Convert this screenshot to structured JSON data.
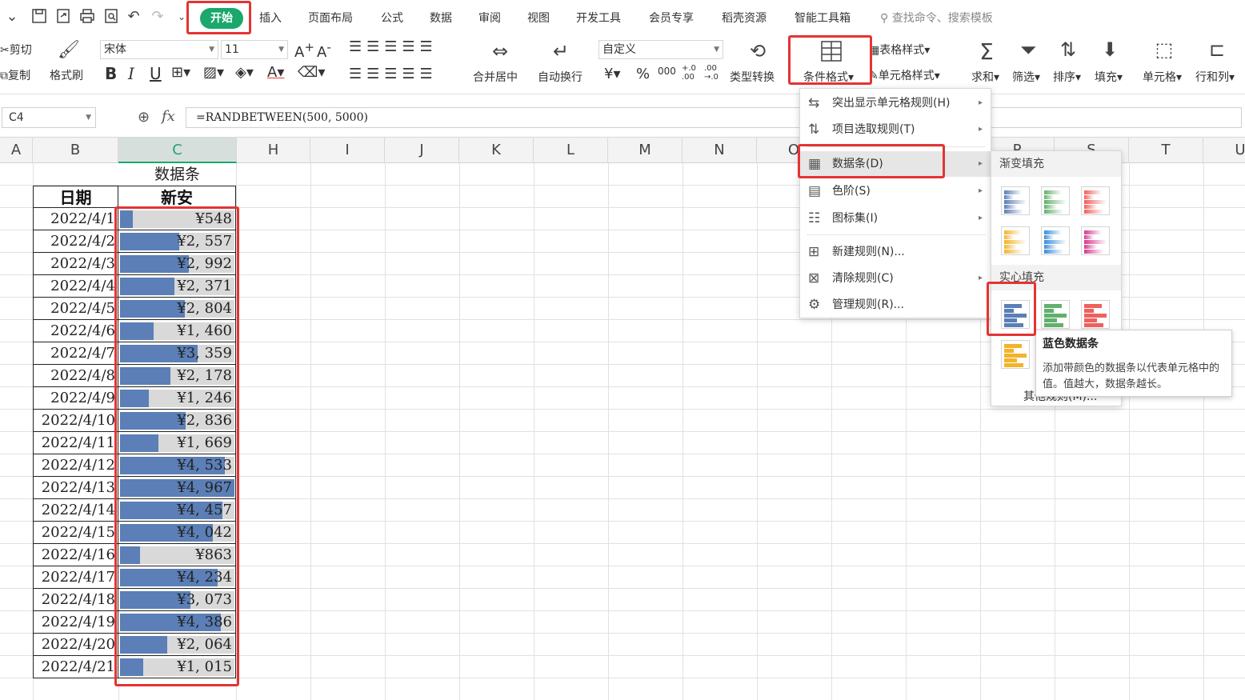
{
  "quick_access": [
    "chevron-down-icon",
    "save-icon",
    "export-icon",
    "print-icon",
    "print-preview-icon",
    "undo-icon",
    "redo-icon",
    "more-icon"
  ],
  "menu_tabs": [
    "开始",
    "插入",
    "页面布局",
    "公式",
    "数据",
    "审阅",
    "视图",
    "开发工具",
    "会员专享",
    "稻壳资源",
    "智能工具箱"
  ],
  "search_placeholder": "查找命令、搜索模板",
  "ribbon": {
    "cut": "剪切",
    "copy": "复制",
    "format_painter": "格式刷",
    "font_name": "宋体",
    "font_size": "11",
    "bold": "B",
    "italic": "I",
    "underline": "U",
    "merge_center": "合并居中",
    "auto_wrap": "自动换行",
    "number_format": "自定义",
    "currency": "¥",
    "percent": "%",
    "thousands": "000",
    "inc_decimal": "+.0 .00",
    "dec_decimal": ".00 →.0",
    "type_convert": "类型转换",
    "conditional_format": "条件格式",
    "table_style": "表格样式",
    "cell_style": "单元格样式",
    "sum": "求和",
    "filter": "筛选",
    "sort": "排序",
    "fill": "填充",
    "cell": "单元格",
    "row_col": "行和列"
  },
  "name_box": "C4",
  "formula": "=RANDBETWEEN(500, 5000)",
  "columns": [
    "A",
    "B",
    "C",
    "H",
    "I",
    "J",
    "K",
    "L",
    "M",
    "N",
    "O",
    "P",
    "S",
    "T",
    "U"
  ],
  "sheet": {
    "title": "数据条",
    "header_date": "日期",
    "header_value": "新安",
    "rows": [
      {
        "date": "2022/4/1",
        "value": 548,
        "label": "¥548"
      },
      {
        "date": "2022/4/2",
        "value": 2557,
        "label": "¥2, 557"
      },
      {
        "date": "2022/4/3",
        "value": 2992,
        "label": "¥2, 992"
      },
      {
        "date": "2022/4/4",
        "value": 2371,
        "label": "¥2, 371"
      },
      {
        "date": "2022/4/5",
        "value": 2804,
        "label": "¥2, 804"
      },
      {
        "date": "2022/4/6",
        "value": 1460,
        "label": "¥1, 460"
      },
      {
        "date": "2022/4/7",
        "value": 3359,
        "label": "¥3, 359"
      },
      {
        "date": "2022/4/8",
        "value": 2178,
        "label": "¥2, 178"
      },
      {
        "date": "2022/4/9",
        "value": 1246,
        "label": "¥1, 246"
      },
      {
        "date": "2022/4/10",
        "value": 2836,
        "label": "¥2, 836"
      },
      {
        "date": "2022/4/11",
        "value": 1669,
        "label": "¥1, 669"
      },
      {
        "date": "2022/4/12",
        "value": 4533,
        "label": "¥4, 533"
      },
      {
        "date": "2022/4/13",
        "value": 4967,
        "label": "¥4, 967"
      },
      {
        "date": "2022/4/14",
        "value": 4457,
        "label": "¥4, 457"
      },
      {
        "date": "2022/4/15",
        "value": 4042,
        "label": "¥4, 042"
      },
      {
        "date": "2022/4/16",
        "value": 863,
        "label": "¥863"
      },
      {
        "date": "2022/4/17",
        "value": 4234,
        "label": "¥4, 234"
      },
      {
        "date": "2022/4/18",
        "value": 3073,
        "label": "¥3, 073"
      },
      {
        "date": "2022/4/19",
        "value": 4386,
        "label": "¥4, 386"
      },
      {
        "date": "2022/4/20",
        "value": 2064,
        "label": "¥2, 064"
      },
      {
        "date": "2022/4/21",
        "value": 1015,
        "label": "¥1, 015"
      }
    ]
  },
  "cf_menu": [
    {
      "label": "突出显示单元格规则(H)",
      "icon": "highlight-rules-icon",
      "submenu": true
    },
    {
      "label": "项目选取规则(T)",
      "icon": "top-bottom-rules-icon",
      "submenu": true
    },
    {
      "label": "数据条(D)",
      "icon": "data-bars-icon",
      "submenu": true
    },
    {
      "label": "色阶(S)",
      "icon": "color-scales-icon",
      "submenu": true
    },
    {
      "label": "图标集(I)",
      "icon": "icon-sets-icon",
      "submenu": true
    },
    {
      "label": "新建规则(N)...",
      "icon": "new-rule-icon",
      "submenu": false
    },
    {
      "label": "清除规则(C)",
      "icon": "clear-rules-icon",
      "submenu": true
    },
    {
      "label": "管理规则(R)...",
      "icon": "manage-rules-icon",
      "submenu": false
    }
  ],
  "databar_submenu": {
    "gradient_title": "渐变填充",
    "solid_title": "实心填充",
    "gradient_colors": [
      "#5b7fb6",
      "#63b06d",
      "#f0605d",
      "#f3b32a",
      "#3a8ed8",
      "#d63b8c"
    ],
    "solid_colors": [
      "#5b7fb6",
      "#63b06d",
      "#f0605d",
      "#f3b32a"
    ],
    "other_rules": "其他规则(M)..."
  },
  "tooltip": {
    "title": "蓝色数据条",
    "body": "添加带颜色的数据条以代表单元格中的值。值越大，数据条越长。"
  }
}
